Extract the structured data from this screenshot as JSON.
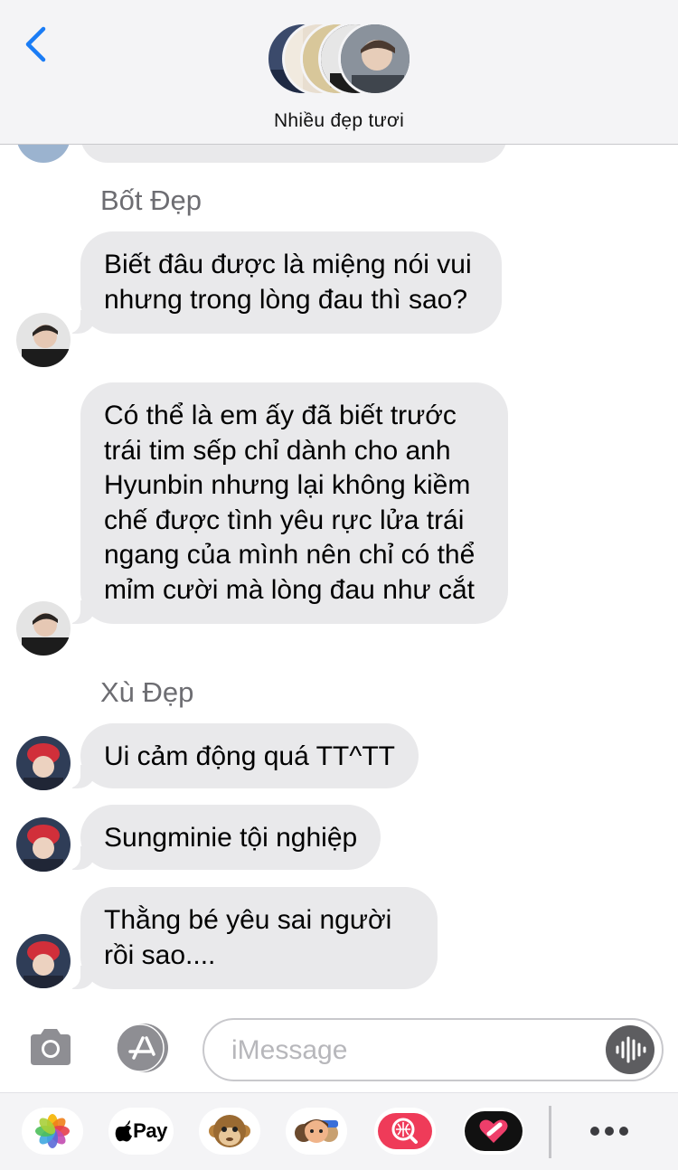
{
  "header": {
    "group_name": "Nhiều đẹp tươi"
  },
  "messages": [
    {
      "sender": "Bốt Đẹp",
      "text": "Biết đâu được là miệng nói vui nhưng trong lòng đau thì sao?"
    },
    {
      "text": "Có thể là em ấy đã biết trước trái tim sếp chỉ dành cho anh Hyunbin nhưng lại không kiềm chế được tình yêu rực lửa trái ngang của mình nên chỉ có thể mỉm cười mà lòng đau như cắt"
    },
    {
      "sender": "Xù Đẹp",
      "text": "Ui cảm động quá TT^TT"
    },
    {
      "text": "Sungminie tội nghiệp"
    },
    {
      "text": "Thằng bé yêu sai người rồi sao...."
    }
  ],
  "input": {
    "placeholder": "iMessage"
  },
  "drawer": {
    "apple_pay_label": "Pay",
    "apps": [
      "photos-icon",
      "apple-pay-icon",
      "monkey-animoji-icon",
      "memoji-icon",
      "image-search-icon",
      "heart-sticker-icon",
      "more-icon"
    ]
  },
  "colors": {
    "accent": "#1a7cf5",
    "bubble": "#e9e9eb",
    "sender_label": "#6d6d72",
    "placeholder": "#b7b7bb"
  }
}
